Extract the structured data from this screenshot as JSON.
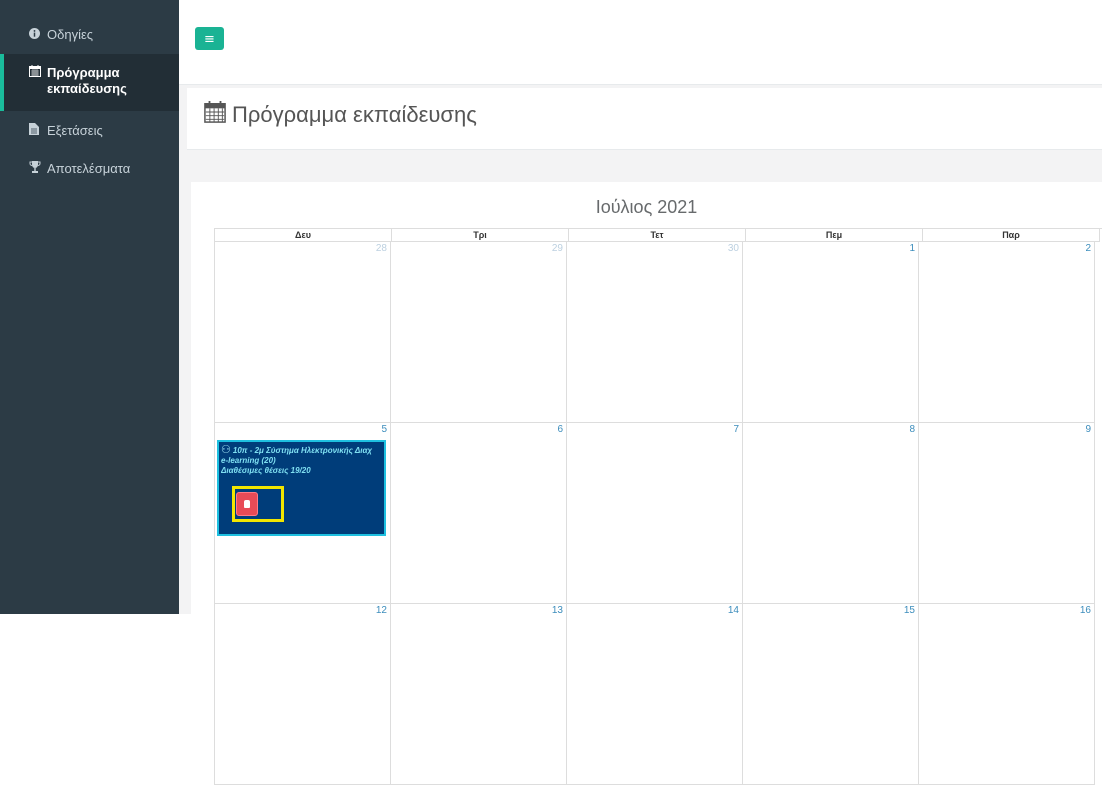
{
  "sidebar": {
    "items": [
      {
        "label": "Οδηγίες",
        "icon": "info-circle-icon"
      },
      {
        "label": "Πρόγραμμα εκπαίδευσης",
        "icon": "calendar-icon"
      },
      {
        "label": "Εξετάσεις",
        "icon": "file-icon"
      },
      {
        "label": "Αποτελέσματα",
        "icon": "trophy-icon"
      }
    ]
  },
  "topbar": {
    "menu_icon": "bars-icon"
  },
  "page": {
    "title": "Πρόγραμμα εκπαίδευσης",
    "title_icon": "calendar-icon"
  },
  "calendar": {
    "month": "Ιούλιος 2021",
    "weekdays": [
      "Δευ",
      "Τρι",
      "Τετ",
      "Πεμ",
      "Παρ"
    ],
    "weeks": [
      [
        "28",
        "29",
        "30",
        "1",
        "2"
      ],
      [
        "5",
        "6",
        "7",
        "8",
        "9"
      ],
      [
        "12",
        "13",
        "14",
        "15",
        "16"
      ]
    ],
    "event": {
      "line1": "10π - 2μ Σύστημα Ηλεκτρονικής Διαχ",
      "line2": "e-learning (20)",
      "line3": "Διαθέσιμες θέσεις 19/20",
      "icon": "graduation-icon"
    }
  },
  "colors": {
    "sidebar_bg": "#2c3b45",
    "accent": "#1ab394",
    "event_bg": "#003d7a",
    "event_border": "#1ec0e0",
    "alert": "#e84b57",
    "highlight": "#f2e600"
  }
}
